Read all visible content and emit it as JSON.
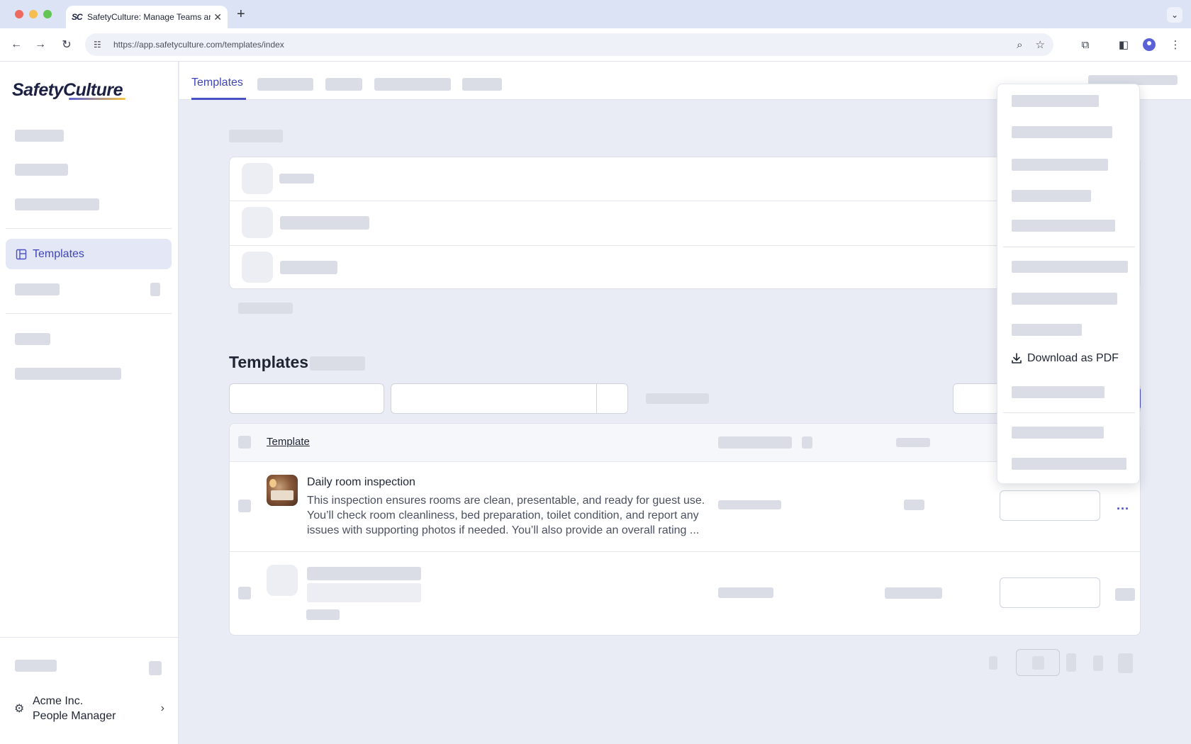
{
  "browser": {
    "tab_title": "SafetyCulture: Manage Teams and...",
    "tab_favicon": "SC",
    "new_tab": "+",
    "url": "https://app.safetyculture.com/templates/index"
  },
  "sidebar": {
    "logo": "SafetyCulture",
    "active_item": {
      "label": "Templates",
      "icon": "template-icon"
    },
    "org": {
      "name": "Acme Inc.",
      "role": "People Manager"
    }
  },
  "main": {
    "active_tab": "Templates",
    "section_title": "Templates",
    "table": {
      "header_template": "Template",
      "rows": [
        {
          "title": "Daily room inspection",
          "description": "This inspection ensures rooms are clean, presentable, and ready for guest use. You’ll check room cleanliness, bed preparation, toilet condition, and report any issues with supporting photos if needed. You’ll also provide an overall rating ..."
        }
      ]
    },
    "row_menu": "..."
  },
  "dropdown_menu": {
    "download_pdf": "Download as PDF"
  }
}
